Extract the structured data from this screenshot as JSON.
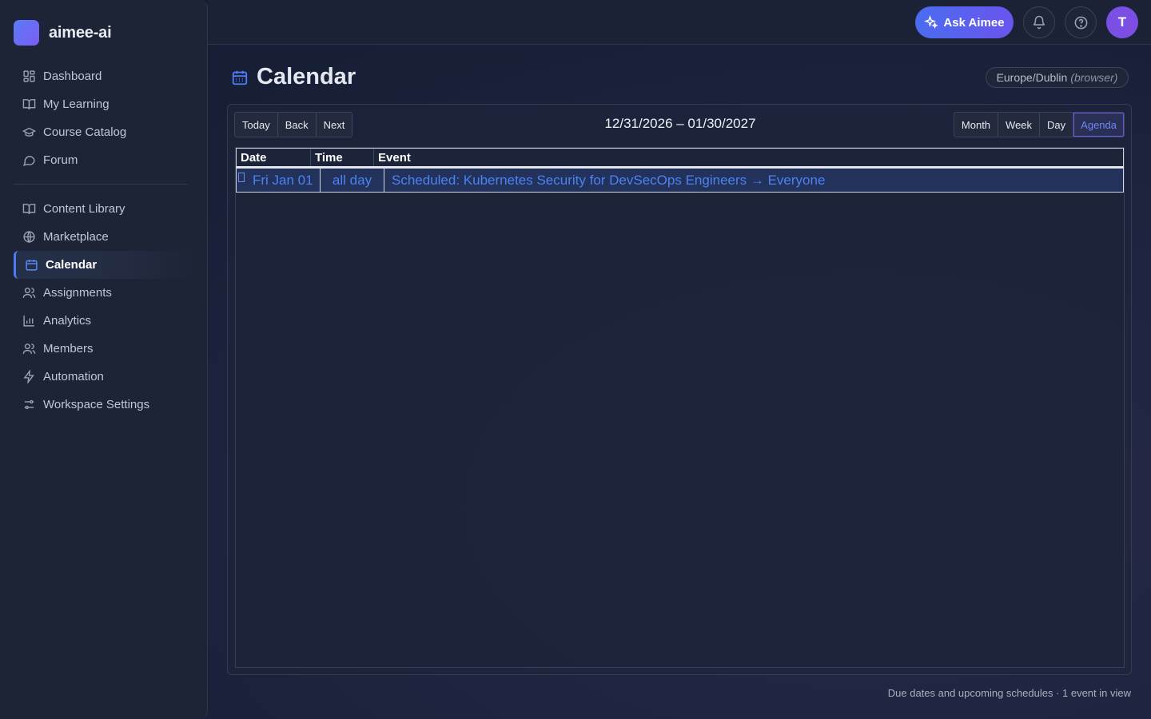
{
  "brand": {
    "name": "aimee-ai"
  },
  "nav_primary": [
    {
      "label": "Dashboard",
      "icon": "dashboard-icon"
    },
    {
      "label": "My Learning",
      "icon": "book-icon"
    },
    {
      "label": "Course Catalog",
      "icon": "graduation-cap-icon"
    },
    {
      "label": "Forum",
      "icon": "chat-bubble-icon"
    }
  ],
  "nav_secondary": [
    {
      "label": "Content Library",
      "icon": "book-icon"
    },
    {
      "label": "Marketplace",
      "icon": "globe-icon"
    },
    {
      "label": "Calendar",
      "icon": "calendar-icon",
      "active": true
    },
    {
      "label": "Assignments",
      "icon": "users-icon"
    },
    {
      "label": "Analytics",
      "icon": "bar-chart-icon"
    },
    {
      "label": "Members",
      "icon": "users-icon"
    },
    {
      "label": "Automation",
      "icon": "lightning-icon"
    },
    {
      "label": "Workspace Settings",
      "icon": "sliders-icon"
    }
  ],
  "topbar": {
    "ask_label": "Ask Aimee",
    "avatar_initial": "T",
    "accent_color": "#4a6cf0"
  },
  "page": {
    "title": "Calendar",
    "timezone": "Europe/Dublin",
    "timezone_note": "(browser)"
  },
  "toolbar": {
    "nav_buttons": [
      "Today",
      "Back",
      "Next"
    ],
    "range": "12/31/2026 – 01/30/2027",
    "views": [
      "Month",
      "Week",
      "Day",
      "Agenda"
    ],
    "active_view": "Agenda"
  },
  "agenda": {
    "columns": [
      "Date",
      "Time",
      "Event"
    ],
    "rows": [
      {
        "date": "Fri Jan 01",
        "time": "all day",
        "event": "Scheduled: Kubernetes Security for DevSecOps Engineers → Everyone"
      }
    ]
  },
  "footer": {
    "text": "Due dates and upcoming schedules · 1 event in view"
  }
}
